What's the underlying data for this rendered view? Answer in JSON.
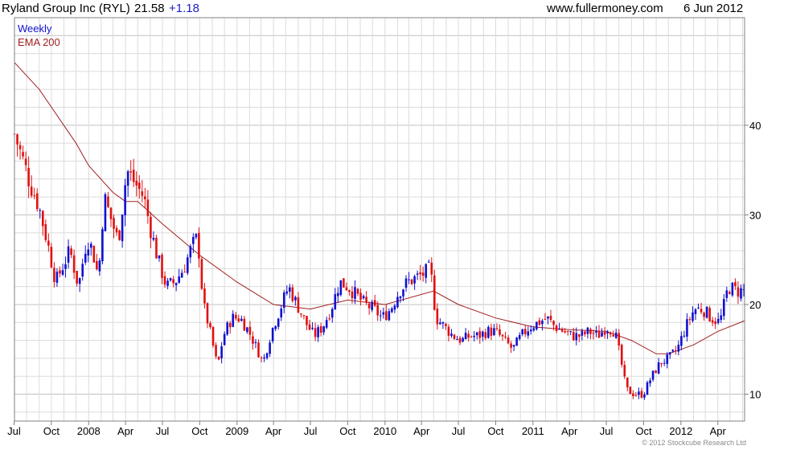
{
  "header": {
    "title": "Ryland Group Inc (RYL)",
    "price": "21.58",
    "change": "+1.18",
    "site": "www.fullermoney.com",
    "date": "6 Jun 2012"
  },
  "copyright": "© 2012 Stockcube Research Ltd",
  "colors": {
    "up": "#1010d0",
    "down": "#e01010",
    "ema": "#a02020",
    "grid": "#dcdcdc",
    "grid_major": "#c0c0c0",
    "axis": "#808080"
  },
  "chart_data": {
    "type": "candlestick",
    "title": "",
    "legend": [
      {
        "label": "Weekly",
        "color": "#1010d0"
      },
      {
        "label": "EMA 200",
        "color": "#a02020"
      }
    ],
    "legend_position": "top-left",
    "grid": true,
    "x_range": [
      "2007-07-02",
      "2012-06-06"
    ],
    "ylim": [
      7,
      52
    ],
    "y_ticks": [
      10,
      20,
      30,
      40
    ],
    "x_ticks": [
      {
        "label": "Jul",
        "date": "2007-07-01"
      },
      {
        "label": "Oct",
        "date": "2007-10-01"
      },
      {
        "label": "2008",
        "date": "2008-01-01"
      },
      {
        "label": "Apr",
        "date": "2008-04-01"
      },
      {
        "label": "Jul",
        "date": "2008-07-01"
      },
      {
        "label": "Oct",
        "date": "2008-10-01"
      },
      {
        "label": "2009",
        "date": "2009-01-01"
      },
      {
        "label": "Apr",
        "date": "2009-04-01"
      },
      {
        "label": "Jul",
        "date": "2009-07-01"
      },
      {
        "label": "Oct",
        "date": "2009-10-01"
      },
      {
        "label": "2010",
        "date": "2010-01-01"
      },
      {
        "label": "Apr",
        "date": "2010-04-01"
      },
      {
        "label": "Jul",
        "date": "2010-07-01"
      },
      {
        "label": "Oct",
        "date": "2010-10-01"
      },
      {
        "label": "2011",
        "date": "2011-01-01"
      },
      {
        "label": "Apr",
        "date": "2011-04-01"
      },
      {
        "label": "Jul",
        "date": "2011-07-01"
      },
      {
        "label": "Oct",
        "date": "2011-10-01"
      },
      {
        "label": "2012",
        "date": "2012-01-01"
      },
      {
        "label": "Apr",
        "date": "2012-04-01"
      }
    ],
    "close_path": [
      [
        "2007-07-02",
        39.0
      ],
      [
        "2007-07-20",
        36.5
      ],
      [
        "2007-08-10",
        33.5
      ],
      [
        "2007-08-31",
        31.0
      ],
      [
        "2007-09-21",
        27.0
      ],
      [
        "2007-10-12",
        22.5
      ],
      [
        "2007-10-26",
        24.0
      ],
      [
        "2007-11-16",
        26.0
      ],
      [
        "2007-12-07",
        22.0
      ],
      [
        "2007-12-28",
        27.5
      ],
      [
        "2008-01-11",
        26.0
      ],
      [
        "2008-01-25",
        23.0
      ],
      [
        "2008-02-08",
        32.0
      ],
      [
        "2008-02-22",
        30.0
      ],
      [
        "2008-03-14",
        27.0
      ],
      [
        "2008-04-04",
        35.0
      ],
      [
        "2008-04-25",
        33.5
      ],
      [
        "2008-05-16",
        32.0
      ],
      [
        "2008-05-30",
        29.0
      ],
      [
        "2008-06-20",
        25.0
      ],
      [
        "2008-07-11",
        22.0
      ],
      [
        "2008-08-01",
        22.5
      ],
      [
        "2008-08-22",
        24.0
      ],
      [
        "2008-09-12",
        26.5
      ],
      [
        "2008-09-26",
        27.5
      ],
      [
        "2008-10-10",
        20.0
      ],
      [
        "2008-10-24",
        17.5
      ],
      [
        "2008-11-14",
        13.0
      ],
      [
        "2008-11-28",
        16.5
      ],
      [
        "2008-12-19",
        18.5
      ],
      [
        "2009-01-09",
        18.5
      ],
      [
        "2009-01-30",
        17.0
      ],
      [
        "2009-02-20",
        15.0
      ],
      [
        "2009-03-06",
        13.5
      ],
      [
        "2009-03-27",
        17.0
      ],
      [
        "2009-04-17",
        19.5
      ],
      [
        "2009-05-08",
        22.0
      ],
      [
        "2009-05-29",
        20.0
      ],
      [
        "2009-06-19",
        18.0
      ],
      [
        "2009-07-10",
        16.5
      ],
      [
        "2009-07-31",
        17.5
      ],
      [
        "2009-08-21",
        19.5
      ],
      [
        "2009-09-11",
        22.5
      ],
      [
        "2009-10-02",
        22.0
      ],
      [
        "2009-10-23",
        21.0
      ],
      [
        "2009-11-13",
        20.0
      ],
      [
        "2009-12-04",
        19.5
      ],
      [
        "2009-12-25",
        18.5
      ],
      [
        "2010-01-15",
        19.5
      ],
      [
        "2010-02-05",
        21.5
      ],
      [
        "2010-02-26",
        22.5
      ],
      [
        "2010-03-19",
        23.0
      ],
      [
        "2010-04-09",
        23.5
      ],
      [
        "2010-04-23",
        24.0
      ],
      [
        "2010-05-07",
        18.5
      ],
      [
        "2010-05-28",
        17.5
      ],
      [
        "2010-06-18",
        16.5
      ],
      [
        "2010-07-09",
        16.0
      ],
      [
        "2010-07-30",
        16.5
      ],
      [
        "2010-08-20",
        16.5
      ],
      [
        "2010-09-10",
        17.0
      ],
      [
        "2010-10-01",
        17.0
      ],
      [
        "2010-10-22",
        16.0
      ],
      [
        "2010-11-12",
        15.0
      ],
      [
        "2010-12-03",
        16.5
      ],
      [
        "2010-12-24",
        17.5
      ],
      [
        "2011-01-14",
        18.0
      ],
      [
        "2011-02-04",
        18.5
      ],
      [
        "2011-02-25",
        17.5
      ],
      [
        "2011-03-18",
        17.0
      ],
      [
        "2011-04-08",
        16.5
      ],
      [
        "2011-04-29",
        16.5
      ],
      [
        "2011-05-20",
        17.0
      ],
      [
        "2011-06-10",
        16.5
      ],
      [
        "2011-07-01",
        17.5
      ],
      [
        "2011-07-22",
        17.0
      ],
      [
        "2011-08-05",
        14.0
      ],
      [
        "2011-08-19",
        10.5
      ],
      [
        "2011-09-09",
        10.0
      ],
      [
        "2011-09-30",
        10.0
      ],
      [
        "2011-10-21",
        12.0
      ],
      [
        "2011-11-11",
        13.5
      ],
      [
        "2011-12-02",
        14.0
      ],
      [
        "2011-12-23",
        15.0
      ],
      [
        "2012-01-13",
        17.5
      ],
      [
        "2012-02-03",
        19.5
      ],
      [
        "2012-02-24",
        19.5
      ],
      [
        "2012-03-16",
        18.5
      ],
      [
        "2012-04-06",
        18.0
      ],
      [
        "2012-04-27",
        22.0
      ],
      [
        "2012-05-18",
        21.5
      ],
      [
        "2012-06-06",
        21.58
      ]
    ],
    "ema_200": [
      [
        "2007-07-02",
        47.0
      ],
      [
        "2007-09-01",
        44.0
      ],
      [
        "2007-12-01",
        38.0
      ],
      [
        "2008-01-01",
        35.5
      ],
      [
        "2008-03-01",
        32.5
      ],
      [
        "2008-04-01",
        31.5
      ],
      [
        "2008-05-01",
        31.5
      ],
      [
        "2008-07-01",
        29.0
      ],
      [
        "2008-10-01",
        25.5
      ],
      [
        "2009-01-01",
        22.5
      ],
      [
        "2009-04-01",
        20.0
      ],
      [
        "2009-07-01",
        19.5
      ],
      [
        "2009-10-01",
        20.5
      ],
      [
        "2010-01-01",
        20.0
      ],
      [
        "2010-05-01",
        21.5
      ],
      [
        "2010-07-01",
        20.0
      ],
      [
        "2010-10-01",
        18.5
      ],
      [
        "2011-01-01",
        17.5
      ],
      [
        "2011-04-01",
        17.2
      ],
      [
        "2011-07-01",
        17.0
      ],
      [
        "2011-09-01",
        16.0
      ],
      [
        "2011-11-01",
        14.5
      ],
      [
        "2011-12-01",
        14.5
      ],
      [
        "2012-02-01",
        15.5
      ],
      [
        "2012-04-01",
        17.0
      ],
      [
        "2012-06-06",
        18.2
      ]
    ]
  }
}
